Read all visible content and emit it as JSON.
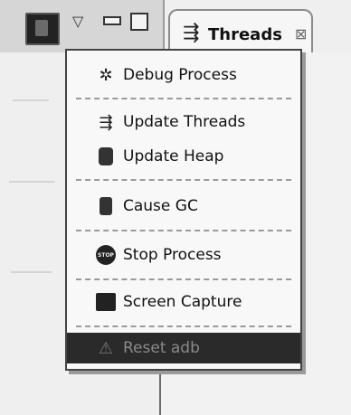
{
  "tab": {
    "label": "Threads",
    "icon": "threads-icon",
    "close_glyph": "⊠"
  },
  "toolbar": {
    "menu_glyph": "▽"
  },
  "menu": {
    "items": [
      {
        "label": "Debug Process",
        "icon": "bug-icon",
        "glyph": "✲"
      },
      {
        "label": "Update Threads",
        "icon": "threads-icon",
        "glyph": "⇶"
      },
      {
        "label": "Update Heap",
        "icon": "heap-icon",
        "glyph": ""
      },
      {
        "label": "Cause GC",
        "icon": "gc-icon",
        "glyph": ""
      },
      {
        "label": "Stop Process",
        "icon": "stop-icon",
        "glyph": "STOP"
      },
      {
        "label": "Screen Capture",
        "icon": "screen-capture-icon",
        "glyph": ""
      },
      {
        "label": "Reset adb",
        "icon": "reset-adb-icon",
        "glyph": "⚠"
      }
    ]
  },
  "colors": {
    "selected_bg": "#2a2a2a",
    "menu_bg": "#f8f8f8"
  }
}
